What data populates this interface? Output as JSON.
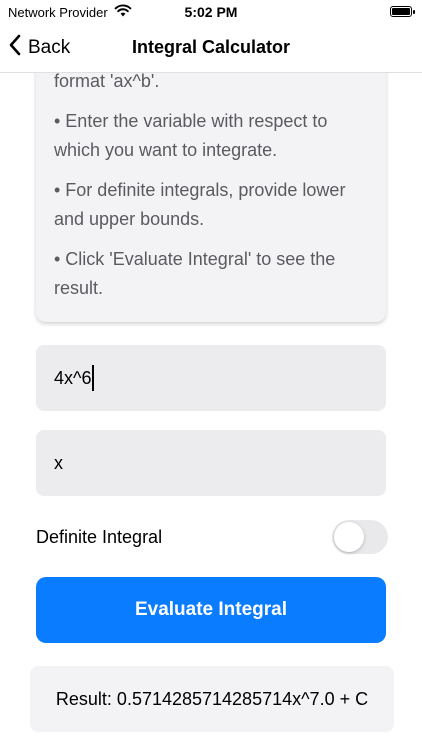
{
  "status_bar": {
    "carrier": "Network Provider",
    "time": "5:02 PM",
    "icons": [
      "wifi-icon",
      "battery-icon"
    ]
  },
  "nav": {
    "back_label": "Back",
    "title": "Integral Calculator"
  },
  "instructions": {
    "lines": [
      "format 'ax^b'.",
      "• Enter the variable with respect to which you want to integrate.",
      "• For definite integrals, provide lower and upper bounds.",
      "• Click 'Evaluate Integral' to see the result."
    ]
  },
  "inputs": {
    "function_value": "4x^6",
    "variable_value": "x"
  },
  "definite": {
    "label": "Definite Integral",
    "enabled": false
  },
  "evaluate_button": {
    "label": "Evaluate Integral"
  },
  "result": {
    "text": "Result: 0.5714285714285714x^7.0 + C"
  },
  "colors": {
    "accent": "#0a7cff",
    "card_bg": "#f3f3f6",
    "input_bg": "#ececee"
  }
}
